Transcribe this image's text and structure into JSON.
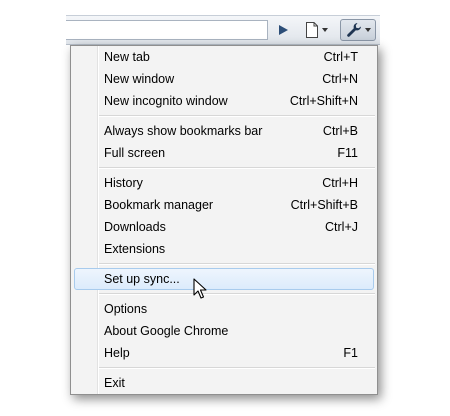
{
  "menu": {
    "groups": [
      [
        {
          "label": "New tab",
          "shortcut": "Ctrl+T"
        },
        {
          "label": "New window",
          "shortcut": "Ctrl+N"
        },
        {
          "label": "New incognito window",
          "shortcut": "Ctrl+Shift+N"
        }
      ],
      [
        {
          "label": "Always show bookmarks bar",
          "shortcut": "Ctrl+B"
        },
        {
          "label": "Full screen",
          "shortcut": "F11"
        }
      ],
      [
        {
          "label": "History",
          "shortcut": "Ctrl+H"
        },
        {
          "label": "Bookmark manager",
          "shortcut": "Ctrl+Shift+B"
        },
        {
          "label": "Downloads",
          "shortcut": "Ctrl+J"
        },
        {
          "label": "Extensions",
          "shortcut": ""
        }
      ],
      [
        {
          "label": "Set up sync...",
          "shortcut": "",
          "highlighted": true
        }
      ],
      [
        {
          "label": "Options",
          "shortcut": ""
        },
        {
          "label": "About Google Chrome",
          "shortcut": ""
        },
        {
          "label": "Help",
          "shortcut": "F1"
        }
      ],
      [
        {
          "label": "Exit",
          "shortcut": ""
        }
      ]
    ]
  },
  "toolbar": {
    "icons": [
      "go-arrow-icon",
      "page-icon",
      "wrench-icon"
    ]
  },
  "colors": {
    "menu_bg": "#f3f3f3",
    "highlight_bg": "#dcebfc",
    "highlight_border": "#a8cbed",
    "separator": "#d7d7d7"
  }
}
